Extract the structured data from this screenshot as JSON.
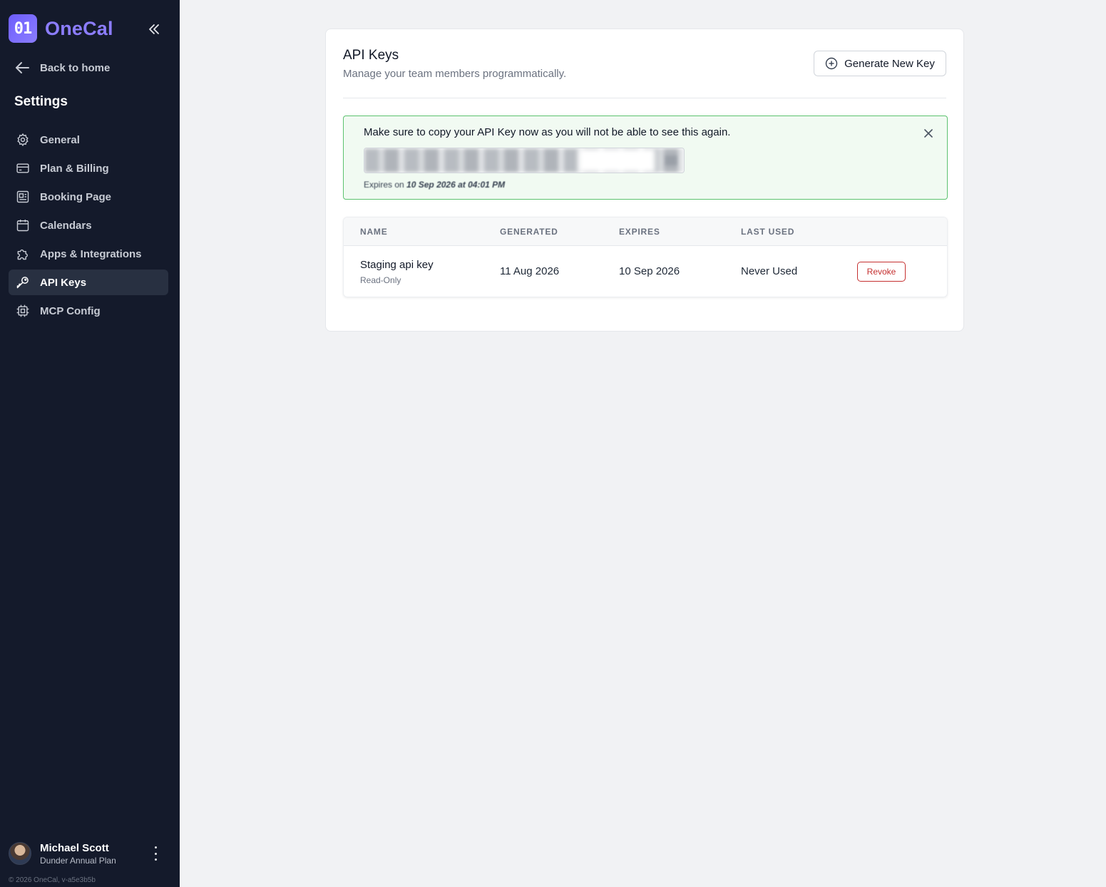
{
  "brand": {
    "logo_mark": "01",
    "name": "OneCal"
  },
  "sidebar": {
    "back_label": "Back to home",
    "settings_title": "Settings",
    "items": [
      {
        "label": "General",
        "icon": "gear-icon"
      },
      {
        "label": "Plan & Billing",
        "icon": "credit-card-icon"
      },
      {
        "label": "Booking Page",
        "icon": "booking-page-icon"
      },
      {
        "label": "Calendars",
        "icon": "calendar-icon"
      },
      {
        "label": "Apps & Integrations",
        "icon": "puzzle-icon"
      },
      {
        "label": "API Keys",
        "icon": "key-icon",
        "active": true
      },
      {
        "label": "MCP Config",
        "icon": "chip-icon"
      }
    ],
    "user": {
      "name": "Michael Scott",
      "plan": "Dunder Annual Plan"
    },
    "copyright": "© 2026 OneCal, v-a5e3b5b"
  },
  "main": {
    "title": "API Keys",
    "subtitle": "Manage your team members programmatically.",
    "generate_label": "Generate New Key",
    "alert": {
      "message": "Make sure to copy your API Key now as you will not be able to see this again.",
      "expires_prefix": "Expires on",
      "expires_value": "10 Sep 2026 at 04:01 PM"
    },
    "table": {
      "headers": [
        "NAME",
        "GENERATED",
        "EXPIRES",
        "LAST USED"
      ],
      "rows": [
        {
          "name": "Staging api key",
          "permission": "Read-Only",
          "generated": "11 Aug 2026",
          "expires": "10 Sep 2026",
          "last_used": "Never Used",
          "action": "Revoke"
        }
      ]
    }
  },
  "colors": {
    "sidebar_bg": "#141a2b",
    "brand_accent": "#8c7dff",
    "alert_border": "#5cc26f",
    "danger": "#c53030"
  }
}
